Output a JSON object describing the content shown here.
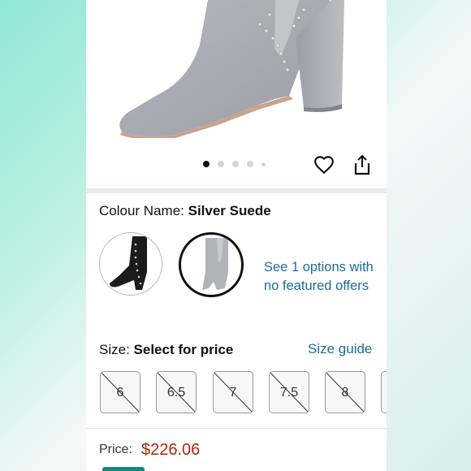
{
  "product": {
    "image_alt": "Silver suede pointed-toe block-heel ankle boot",
    "carousel": {
      "total": 5,
      "active": 1
    }
  },
  "colour": {
    "label": "Colour Name:",
    "value": "Silver Suede",
    "swatches": [
      {
        "name": "Black",
        "selected": false
      },
      {
        "name": "Silver Suede",
        "selected": true
      }
    ],
    "offers_link": "See 1 options with no featured offers"
  },
  "size": {
    "label": "Size:",
    "value": "Select for price",
    "guide_link": "Size guide",
    "options": [
      "6",
      "6.5",
      "7",
      "7.5",
      "8"
    ]
  },
  "price": {
    "label": "Price:",
    "value": "$226.06"
  },
  "colors": {
    "link": "#1a6f9c",
    "price": "#b12704",
    "accent": "#16877d"
  }
}
